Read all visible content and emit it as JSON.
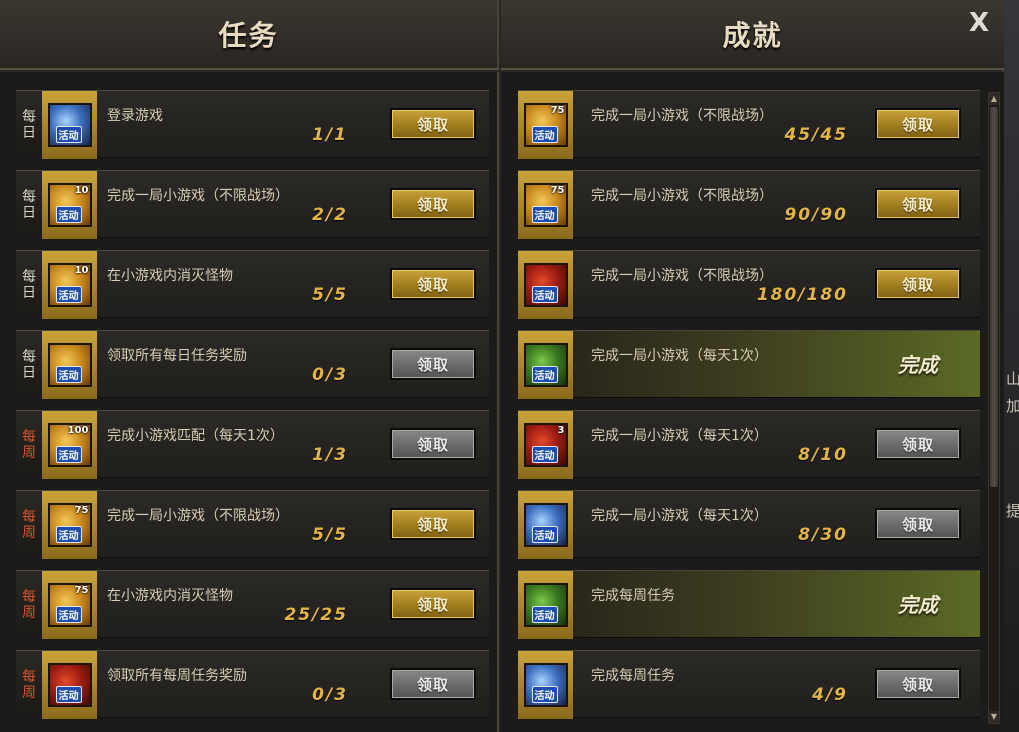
{
  "panels": {
    "tasks_title": "任务",
    "achievements_title": "成就",
    "close_label": "X"
  },
  "tasks": [
    {
      "tag": [
        "每",
        "日"
      ],
      "kind": "daily",
      "title": "登录游戏",
      "progress": "1/1",
      "button": "领取",
      "button_state": "active",
      "icon": "sword-activity-icon",
      "icon_number": "",
      "badge": "活动"
    },
    {
      "tag": [
        "每",
        "日"
      ],
      "kind": "daily",
      "title": "完成一局小游戏（不限战场）",
      "progress": "2/2",
      "button": "领取",
      "button_state": "active",
      "icon": "gold-fist-activity-icon",
      "icon_number": "10",
      "badge": "活动"
    },
    {
      "tag": [
        "每",
        "日"
      ],
      "kind": "daily",
      "title": "在小游戏内消灭怪物",
      "progress": "5/5",
      "button": "领取",
      "button_state": "active",
      "icon": "gold-fist-activity-icon",
      "icon_number": "10",
      "badge": "活动"
    },
    {
      "tag": [
        "每",
        "日"
      ],
      "kind": "daily",
      "title": "领取所有每日任务奖励",
      "progress": "0/3",
      "button": "领取",
      "button_state": "disabled",
      "icon": "scroll-activity-icon",
      "icon_number": "",
      "badge": "活动"
    },
    {
      "tag": [
        "每",
        "周"
      ],
      "kind": "weekly",
      "title": "完成小游戏匹配（每天1次）",
      "progress": "1/3",
      "button": "领取",
      "button_state": "disabled",
      "icon": "gold-fist-activity-icon",
      "icon_number": "100",
      "badge": "活动"
    },
    {
      "tag": [
        "每",
        "周"
      ],
      "kind": "weekly",
      "title": "完成一局小游戏（不限战场）",
      "progress": "5/5",
      "button": "领取",
      "button_state": "active",
      "icon": "gold-fist-activity-icon",
      "icon_number": "75",
      "badge": "活动"
    },
    {
      "tag": [
        "每",
        "周"
      ],
      "kind": "weekly",
      "title": "在小游戏内消灭怪物",
      "progress": "25/25",
      "button": "领取",
      "button_state": "active",
      "icon": "gold-fist-activity-icon",
      "icon_number": "75",
      "badge": "活动"
    },
    {
      "tag": [
        "每",
        "周"
      ],
      "kind": "weekly",
      "title": "领取所有每周任务奖励",
      "progress": "0/3",
      "button": "领取",
      "button_state": "disabled",
      "icon": "red-sword-activity-icon",
      "icon_number": "",
      "badge": "活动"
    }
  ],
  "achievements": [
    {
      "title": "完成一局小游戏（不限战场）",
      "progress": "45/45",
      "button": "领取",
      "state": "active",
      "icon": "gold-fist-activity-icon",
      "icon_number": "75",
      "badge": "活动"
    },
    {
      "title": "完成一局小游戏（不限战场）",
      "progress": "90/90",
      "button": "领取",
      "state": "active",
      "icon": "gold-fist-activity-icon",
      "icon_number": "75",
      "badge": "活动"
    },
    {
      "title": "完成一局小游戏（不限战场）",
      "progress": "180/180",
      "button": "领取",
      "state": "active",
      "icon": "gift-box-activity-icon",
      "icon_number": "",
      "badge": "活动"
    },
    {
      "title": "完成一局小游戏（每天1次）",
      "progress": "",
      "button": "完成",
      "state": "done",
      "icon": "checkmark-activity-icon",
      "icon_number": "",
      "badge": "活动"
    },
    {
      "title": "完成一局小游戏（每天1次）",
      "progress": "8/10",
      "button": "领取",
      "state": "disabled",
      "icon": "red-sword-activity-icon",
      "icon_number": "3",
      "badge": "活动"
    },
    {
      "title": "完成一局小游戏（每天1次）",
      "progress": "8/30",
      "button": "领取",
      "state": "disabled",
      "icon": "blue-sword-activity-icon",
      "icon_number": "",
      "badge": "活动"
    },
    {
      "title": "完成每周任务",
      "progress": "",
      "button": "完成",
      "state": "done",
      "icon": "checkmark-activity-icon",
      "icon_number": "",
      "badge": "活动"
    },
    {
      "title": "完成每周任务",
      "progress": "4/9",
      "button": "领取",
      "state": "disabled",
      "icon": "blue-sword-activity-icon",
      "icon_number": "",
      "badge": "活动"
    }
  ],
  "outside_peek": [
    "山",
    "加",
    "提"
  ],
  "colors": {
    "gold_button": "#a2801f",
    "grey_button": "#6c6c6c",
    "progress_text": "#e3b548",
    "weekly_tag": "#d2572e",
    "done_bg": "#5b6a24"
  }
}
